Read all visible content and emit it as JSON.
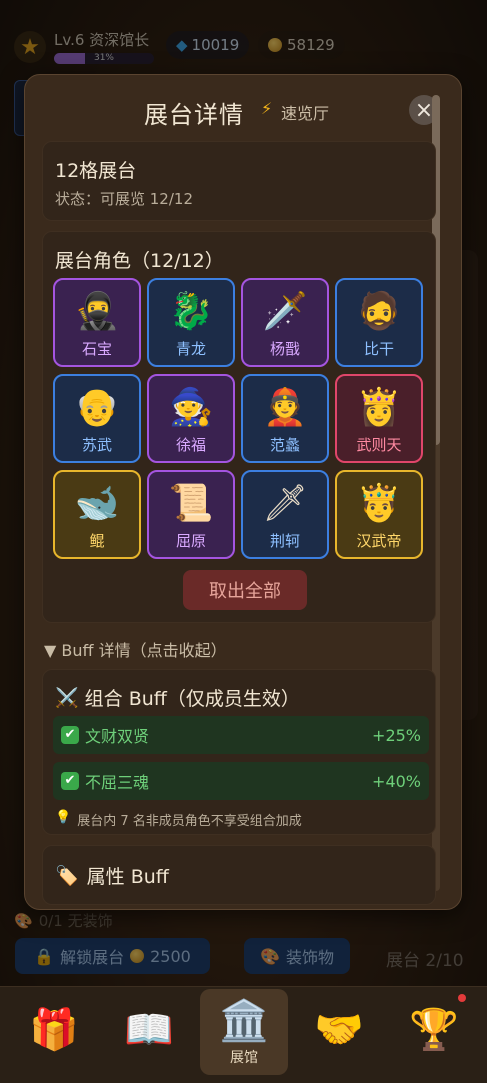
{
  "top": {
    "level_text": "Lv.6 资深馆长",
    "xp_percent": "31%",
    "xp_fraction": 0.31,
    "gems": "10019",
    "coins": "58129"
  },
  "modal": {
    "title": "展台详情",
    "subtitle": "速览厅",
    "booth_title": "12格展台",
    "booth_status": "状态：可展览 12/12",
    "roles_title": "展台角色（12/12）",
    "characters": [
      {
        "name": "石宝",
        "rarity": "purple",
        "icon": "🥷"
      },
      {
        "name": "青龙",
        "rarity": "blue",
        "icon": "🐉"
      },
      {
        "name": "杨戬",
        "rarity": "purple",
        "icon": "🗡️"
      },
      {
        "name": "比干",
        "rarity": "blue",
        "icon": "🧔"
      },
      {
        "name": "苏武",
        "rarity": "blue",
        "icon": "👴"
      },
      {
        "name": "徐福",
        "rarity": "purple",
        "icon": "🧙"
      },
      {
        "name": "范蠡",
        "rarity": "blue",
        "icon": "👲"
      },
      {
        "name": "武则天",
        "rarity": "red",
        "icon": "👸"
      },
      {
        "name": "鲲",
        "rarity": "gold",
        "icon": "🐋"
      },
      {
        "name": "屈原",
        "rarity": "purple",
        "icon": "📜"
      },
      {
        "name": "荆轲",
        "rarity": "blue",
        "icon": "🗡"
      },
      {
        "name": "汉武帝",
        "rarity": "gold",
        "icon": "🤴"
      }
    ],
    "take_all_label": "取出全部",
    "buff_toggle": "▼ Buff 详情（点击收起）",
    "combo_title": "组合 Buff（仅成员生效）",
    "combo_icon": "⚔️",
    "buffs": [
      {
        "name": "文财双贤",
        "value": "+25%"
      },
      {
        "name": "不屈三魂",
        "value": "+40%"
      }
    ],
    "note": "展台内 7 名非成员角色不享受组合加成",
    "attr_title": "属性 Buff",
    "attr_icon": "🏷️"
  },
  "bottom": {
    "decoration_text": "0/1 无装饰",
    "unlock_label": "解锁展台",
    "unlock_cost": "2500",
    "decor_label": "装饰物",
    "page_info": "展台 2/10"
  },
  "nav": [
    {
      "label": "",
      "icon": "🎁"
    },
    {
      "label": "",
      "icon": "📖"
    },
    {
      "label": "展馆",
      "icon": "🏛️"
    },
    {
      "label": "",
      "icon": "🤝"
    },
    {
      "label": "",
      "icon": "🏆"
    }
  ]
}
